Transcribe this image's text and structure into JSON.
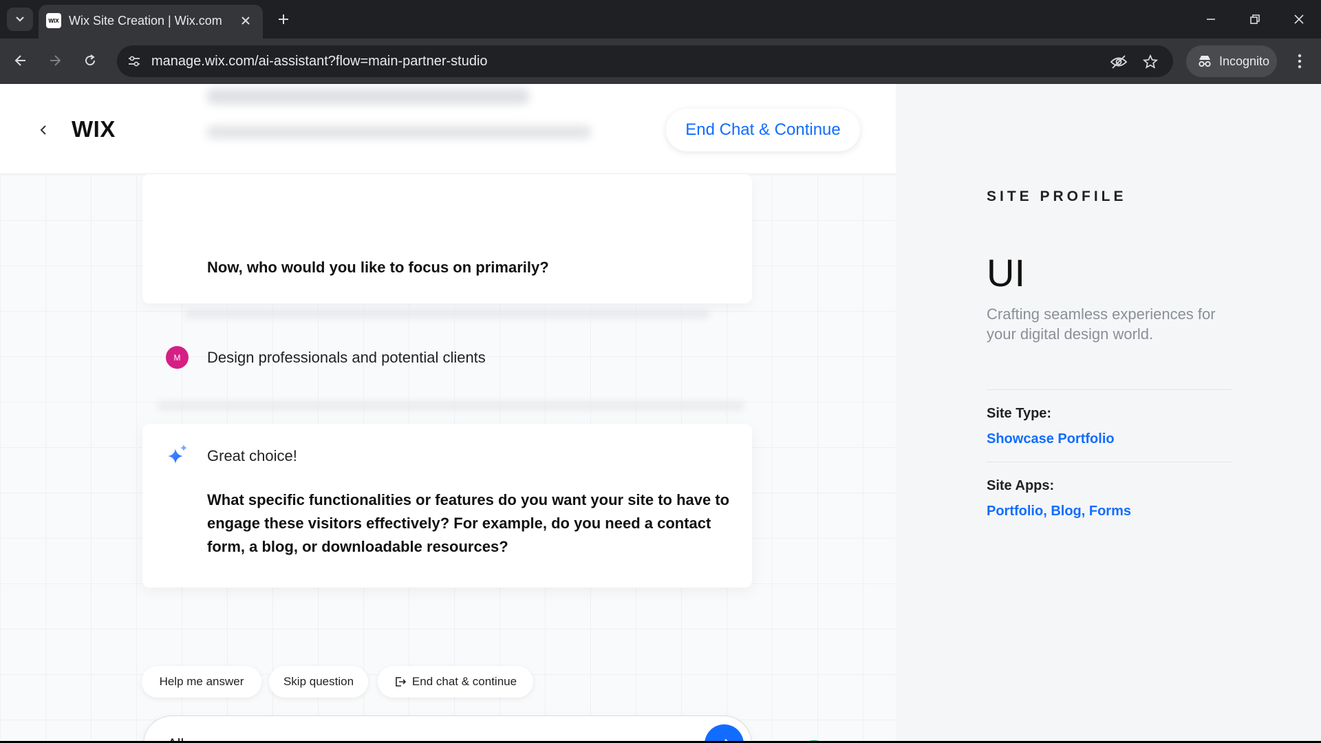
{
  "browser": {
    "tab_title": "Wix Site Creation | Wix.com",
    "url": "manage.wix.com/ai-assistant?flow=main-partner-studio",
    "incognito_label": "Incognito",
    "favicon_text": "WIX"
  },
  "header": {
    "logo": "WIX",
    "end_chat_label": "End Chat & Continue"
  },
  "chat": {
    "previous_question": "Now, who would you like to focus on primarily?",
    "user_avatar_initial": "M",
    "user_answer": "Design professionals and potential clients",
    "ai_ack": "Great choice!",
    "ai_question": "What specific functionalities or features do you want your site to have to engage these visitors effectively? For example, do you need a contact form, a blog, or downloadable resources?"
  },
  "actions": {
    "help_label": "Help me answer",
    "skip_label": "Skip question",
    "end_chat_label": "End chat & continue"
  },
  "input": {
    "value": "All"
  },
  "profile": {
    "label": "SITE PROFILE",
    "site_name": "UI",
    "tagline": "Crafting seamless experiences for your digital design world.",
    "site_type_label": "Site Type:",
    "site_type_value": "Showcase Portfolio",
    "site_apps_label": "Site Apps:",
    "site_apps_value": "Portfolio, Blog, Forms"
  },
  "colors": {
    "accent": "#116dff",
    "avatar": "#d61f85",
    "grammarly": "#15c39a"
  }
}
